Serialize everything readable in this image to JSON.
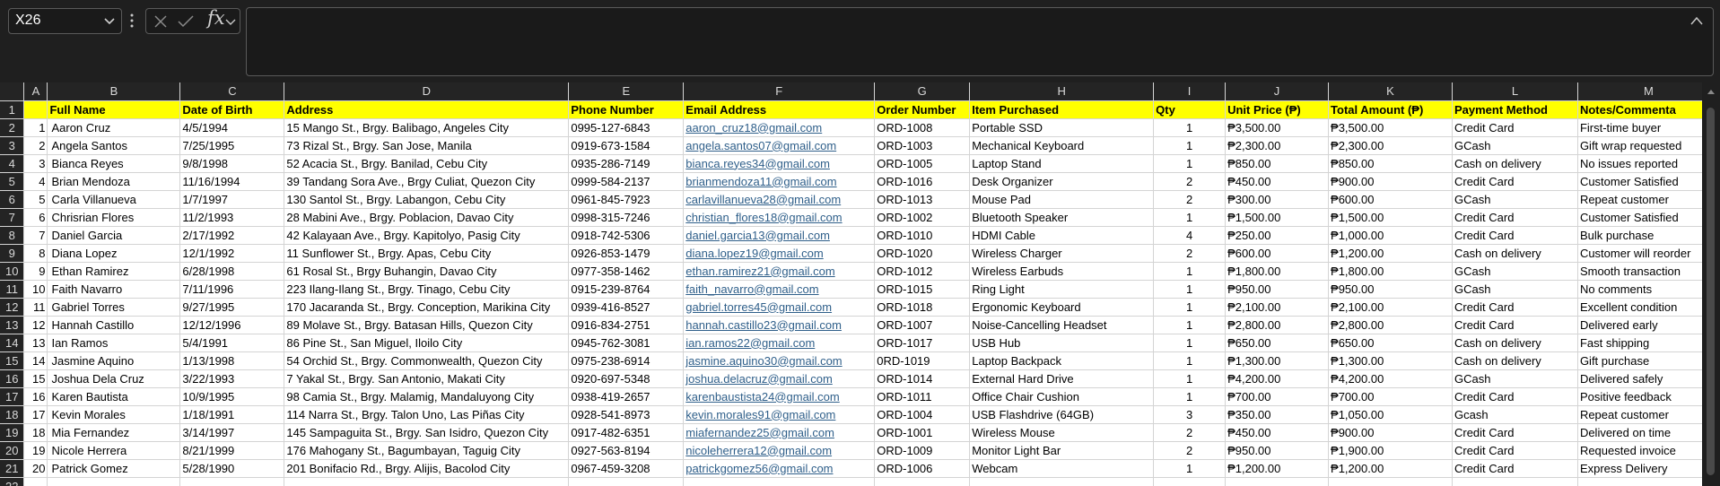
{
  "formula_bar": {
    "name_box_value": "X26",
    "fx_label": "fx",
    "formula_value": ""
  },
  "columns": [
    "A",
    "B",
    "C",
    "D",
    "E",
    "F",
    "G",
    "H",
    "I",
    "J",
    "K",
    "L",
    "M"
  ],
  "headers": [
    "",
    "Full Name",
    "Date of Birth",
    "Address",
    "Phone Number",
    "Email Address",
    "Order Number",
    "Item Purchased",
    "Qty",
    "Unit Price (₱)",
    "Total Amount (₱)",
    "Payment Method",
    "Notes/Commenta"
  ],
  "rows": [
    [
      "1",
      "Aaron Cruz",
      "4/5/1994",
      "15 Mango St., Brgy. Balibago, Angeles City",
      "0995-127-6843",
      "aaron_cruz18@gmail.com",
      "ORD-1008",
      "Portable SSD",
      "1",
      "₱3,500.00",
      "₱3,500.00",
      "Credit Card",
      "First-time buyer"
    ],
    [
      "2",
      "Angela Santos",
      "7/25/1995",
      "73 Rizal St., Brgy. San Jose, Manila",
      "0919-673-1584",
      "angela.santos07@gmail.com",
      "ORD-1003",
      "Mechanical Keyboard",
      "1",
      "₱2,300.00",
      "₱2,300.00",
      "GCash",
      "Gift wrap requested"
    ],
    [
      "3",
      "Bianca Reyes",
      "9/8/1998",
      "52 Acacia St., Brgy. Banilad, Cebu City",
      "0935-286-7149",
      "bianca.reyes34@gmail.com",
      "ORD-1005",
      "Laptop Stand",
      "1",
      "₱850.00",
      "₱850.00",
      "Cash on delivery",
      "No issues reported"
    ],
    [
      "4",
      "Brian Mendoza",
      "11/16/1994",
      "39 Tandang Sora Ave., Brgy Culiat, Quezon City",
      "0999-584-2137",
      "brianmendoza11@gmail.com",
      "ORD-1016",
      "Desk Organizer",
      "2",
      "₱450.00",
      "₱900.00",
      "Credit Card",
      "Customer Satisfied"
    ],
    [
      "5",
      "Carla Villanueva",
      "1/7/1997",
      "130 Santol St., Brgy. Labangon, Cebu City",
      "0961-845-7923",
      "carlavillanueva28@gmail.com",
      "ORD-1013",
      "Mouse Pad",
      "2",
      "₱300.00",
      "₱600.00",
      "GCash",
      "Repeat customer"
    ],
    [
      "6",
      "Chrisrian Flores",
      "11/2/1993",
      "28 Mabini Ave., Brgy. Poblacion, Davao City",
      "0998-315-7246",
      "christian_flores18@gmail.com",
      "ORD-1002",
      "Bluetooth Speaker",
      "1",
      "₱1,500.00",
      "₱1,500.00",
      "Credit Card",
      "Customer Satisfied"
    ],
    [
      "7",
      "Daniel Garcia",
      "2/17/1992",
      "42 Kalayaan Ave., Brgy. Kapitolyo, Pasig City",
      "0918-742-5306",
      "daniel.garcia13@gmail.com",
      "ORD-1010",
      "HDMI Cable",
      "4",
      "₱250.00",
      "₱1,000.00",
      "Credit Card",
      "Bulk purchase"
    ],
    [
      "8",
      "Diana Lopez",
      "12/1/1992",
      "11 Sunflower St., Brgy. Apas, Cebu City",
      "0926-853-1479",
      "diana.lopez19@gmail.com",
      "ORD-1020",
      "Wireless Charger",
      "2",
      "₱600.00",
      "₱1,200.00",
      "Cash on delivery",
      "Customer will reorder"
    ],
    [
      "9",
      "Ethan Ramirez",
      "6/28/1998",
      "61 Rosal St., Brgy Buhangin, Davao City",
      "0977-358-1462",
      "ethan.ramirez21@gmail.com",
      "ORD-1012",
      "Wireless Earbuds",
      "1",
      "₱1,800.00",
      "₱1,800.00",
      "GCash",
      "Smooth transaction"
    ],
    [
      "10",
      "Faith Navarro",
      "7/11/1996",
      "223 Ilang-Ilang St., Brgy. Tinago, Cebu City",
      "0915-239-8764",
      "faith_navarro@gmail.com",
      "ORD-1015",
      "Ring Light",
      "1",
      "₱950.00",
      "₱950.00",
      "GCash",
      "No comments"
    ],
    [
      "11",
      "Gabriel Torres",
      "9/27/1995",
      "170 Jacaranda St., Brgy. Conception, Marikina City",
      "0939-416-8527",
      "gabriel.torres45@gmail.com",
      "ORD-1018",
      "Ergonomic Keyboard",
      "1",
      "₱2,100.00",
      "₱2,100.00",
      "Credit Card",
      "Excellent condition"
    ],
    [
      "12",
      "Hannah Castillo",
      "12/12/1996",
      "89 Molave St., Brgy. Batasan Hills, Quezon City",
      "0916-834-2751",
      "hannah.castillo23@gmail.com",
      "ORD-1007",
      "Noise-Cancelling Headset",
      "1",
      "₱2,800.00",
      "₱2,800.00",
      "Credit Card",
      "Delivered early"
    ],
    [
      "13",
      "Ian Ramos",
      "5/4/1991",
      "86 Pine St., San Miguel, Iloilo City",
      "0945-762-3081",
      "ian.ramos22@gmail.com",
      "ORD-1017",
      "USB Hub",
      "1",
      "₱650.00",
      "₱650.00",
      "Cash on delivery",
      "Fast shipping"
    ],
    [
      "14",
      "Jasmine Aquino",
      "1/13/1998",
      "54 Orchid St., Brgy. Commonwealth, Quezon City",
      "0975-238-6914",
      "jasmine.aquino30@gmail.com",
      "0RD-1019",
      "Laptop Backpack",
      "1",
      "₱1,300.00",
      "₱1,300.00",
      "Cash on delivery",
      "Gift purchase"
    ],
    [
      "15",
      "Joshua Dela Cruz",
      "3/22/1993",
      "7 Yakal St., Brgy. San Antonio, Makati City",
      "0920-697-5348",
      "joshua.delacruz@gmail.com",
      "ORD-1014",
      "External Hard Drive",
      "1",
      "₱4,200.00",
      "₱4,200.00",
      "GCash",
      "Delivered safely"
    ],
    [
      "16",
      "Karen Bautista",
      "10/9/1995",
      "98 Camia St., Brgy. Malamig, Mandaluyong City",
      "0938-419-2657",
      "karenbaustista24@gmail.com",
      "ORD-1011",
      "Office Chair Cushion",
      "1",
      "₱700.00",
      "₱700.00",
      "Credit Card",
      "Positive feedback"
    ],
    [
      "17",
      "Kevin Morales",
      "1/18/1991",
      "114 Narra St., Brgy. Talon Uno, Las Piñas City",
      "0928-541-8973",
      "kevin.morales91@gmail.com",
      "ORD-1004",
      "USB Flashdrive (64GB)",
      "3",
      "₱350.00",
      "₱1,050.00",
      "Gcash",
      "Repeat customer"
    ],
    [
      "18",
      "Mia Fernandez",
      "3/14/1997",
      "145 Sampaguita St., Brgy. San Isidro, Quezon City",
      "0917-482-6351",
      "miafernandez25@gmail.com",
      "ORD-1001",
      "Wireless Mouse",
      "2",
      "₱450.00",
      "₱900.00",
      "Credit Card",
      "Delivered on time"
    ],
    [
      "19",
      "Nicole Herrera",
      "8/21/1999",
      "176 Mahogany St., Bagumbayan, Taguig City",
      "0927-563-8194",
      "nicoleherrera12@gmail.com",
      "ORD-1009",
      "Monitor Light Bar",
      "2",
      "₱950.00",
      "₱1,900.00",
      "Credit Card",
      "Requested invoice"
    ],
    [
      "20",
      "Patrick Gomez",
      "5/28/1990",
      "201 Bonifacio Rd., Brgy. Alijis, Bacolod City",
      "0967-459-3208",
      "patrickgomez56@gmail.com",
      "ORD-1006",
      "Webcam",
      "1",
      "₱1,200.00",
      "₱1,200.00",
      "Credit Card",
      "Express Delivery"
    ]
  ],
  "row_numbers": [
    "1",
    "2",
    "3",
    "4",
    "5",
    "6",
    "7",
    "8",
    "9",
    "10",
    "11",
    "12",
    "13",
    "14",
    "15",
    "16",
    "17",
    "18",
    "19",
    "20",
    "21",
    "22"
  ]
}
